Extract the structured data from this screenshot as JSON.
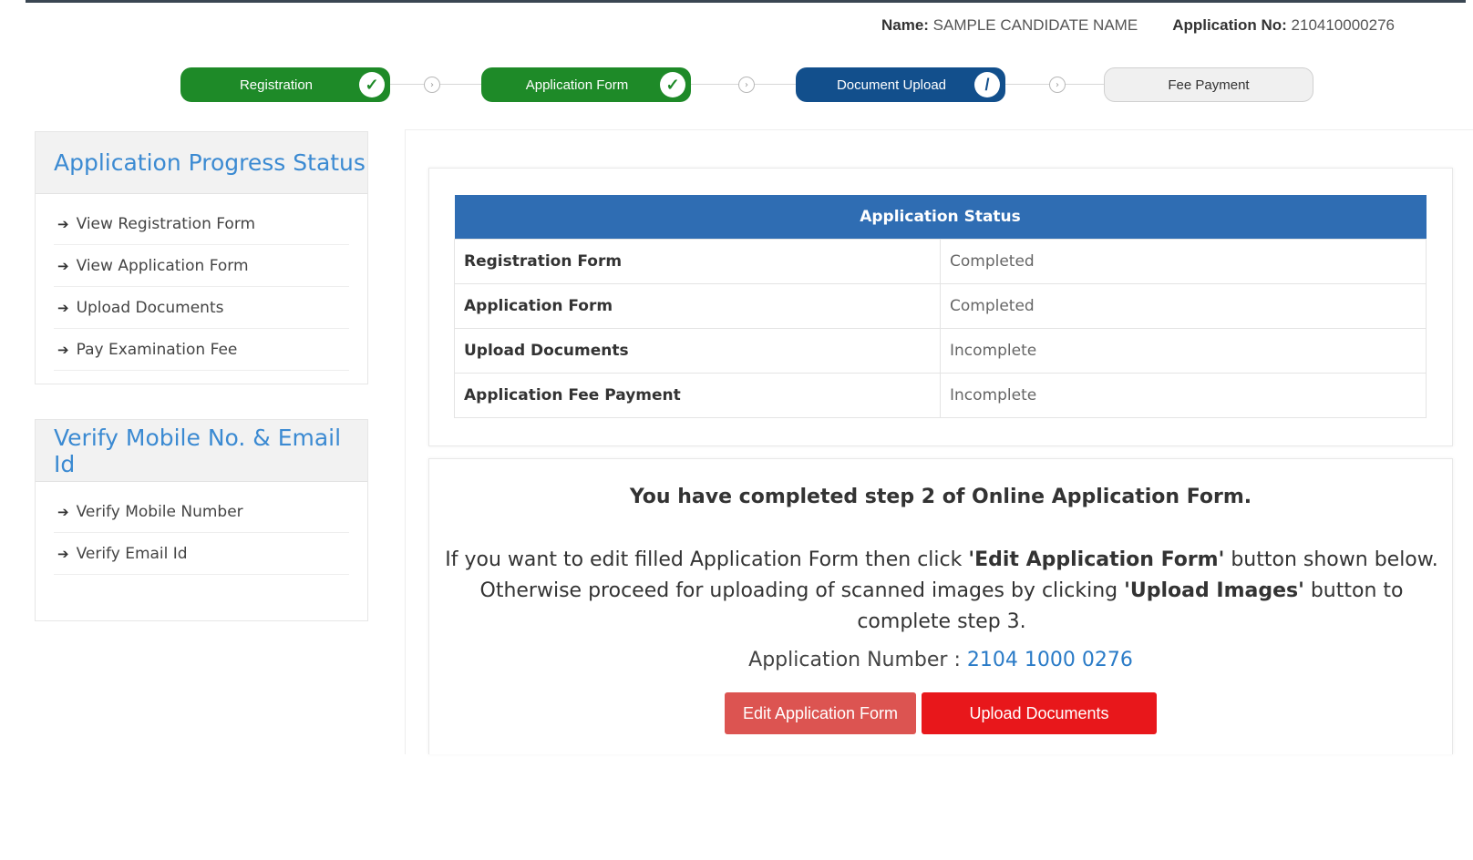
{
  "header": {
    "name_label": "Name:",
    "name_value": "SAMPLE CANDIDATE NAME",
    "appno_label": "Application No:",
    "appno_value": "210410000276"
  },
  "steps": [
    {
      "label": "Registration",
      "state": "done",
      "check": "✓"
    },
    {
      "label": "Application Form",
      "state": "done",
      "check": "✓"
    },
    {
      "label": "Document Upload",
      "state": "active",
      "check": "/"
    },
    {
      "label": "Fee Payment",
      "state": "pending"
    }
  ],
  "sidebar": {
    "progress": {
      "title": "Application Progress Status",
      "items": [
        "View Registration Form",
        "View Application Form",
        "Upload Documents",
        "Pay Examination Fee"
      ]
    },
    "verify": {
      "title": "Verify Mobile No. & Email Id",
      "items": [
        "Verify Mobile Number",
        "Verify Email Id"
      ]
    }
  },
  "status_table": {
    "header": "Application Status",
    "rows": [
      {
        "item": "Registration Form",
        "status": "Completed"
      },
      {
        "item": "Application Form",
        "status": "Completed"
      },
      {
        "item": "Upload Documents",
        "status": "Incomplete"
      },
      {
        "item": "Application Fee Payment",
        "status": "Incomplete"
      }
    ]
  },
  "message": {
    "title": "You have completed step 2 of Online Application Form.",
    "line1_pre": "If you want to edit filled Application Form then click ",
    "line1_bold": "'Edit Application Form'",
    "line1_post": " button shown below.",
    "line2_pre": "Otherwise proceed for uploading of scanned images by clicking ",
    "line2_bold": "'Upload Images'",
    "line2_post": " button to complete step 3.",
    "app_number_label": "Application Number : ",
    "app_number_value": "2104 1000 0276"
  },
  "buttons": {
    "edit": "Edit Application Form",
    "upload": "Upload Documents"
  },
  "colors": {
    "done": "#1e8a28",
    "active": "#124f8c",
    "table_header": "#2f6db3",
    "edit_button": "#dc5451",
    "upload_button": "#e8171b",
    "link_blue": "#3b8ad2"
  },
  "icons": {
    "step_check": "check-icon",
    "list_bullet": "arrow-right-icon",
    "step_node": "circle-arrow-icon"
  }
}
